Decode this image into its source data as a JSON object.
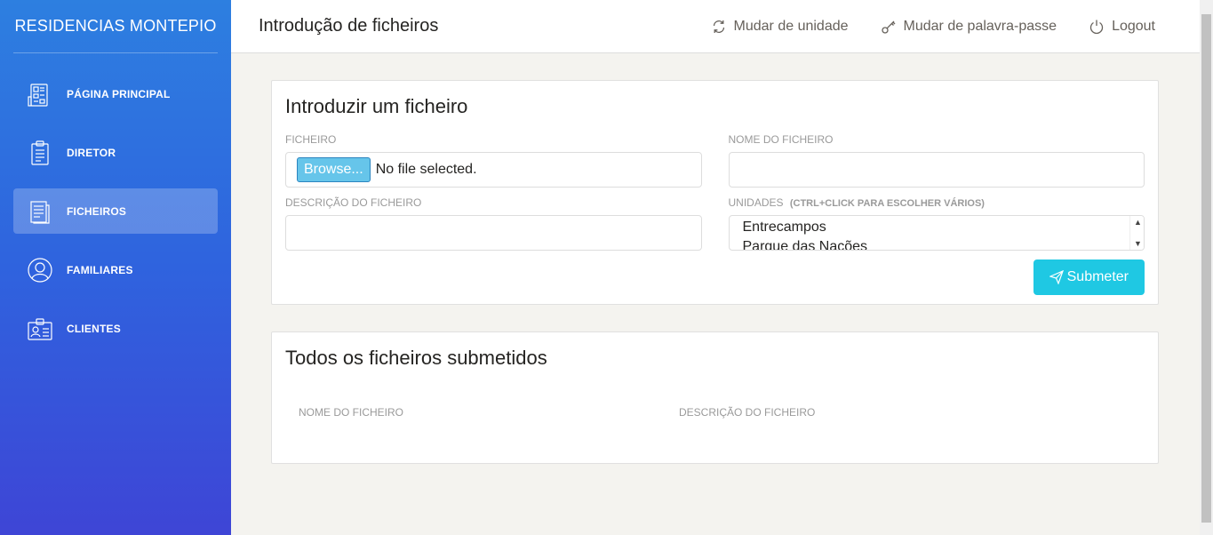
{
  "sidebar": {
    "brand": "RESIDENCIAS MONTEPIO",
    "items": [
      {
        "label": "PÁGINA PRINCIPAL",
        "icon": "dashboard-icon",
        "active": false
      },
      {
        "label": "DIRETOR",
        "icon": "clipboard-icon",
        "active": false
      },
      {
        "label": "FICHEIROS",
        "icon": "document-icon",
        "active": true
      },
      {
        "label": "FAMILIARES",
        "icon": "user-circle-icon",
        "active": false
      },
      {
        "label": "CLIENTES",
        "icon": "id-badge-icon",
        "active": false
      }
    ]
  },
  "header": {
    "title": "Introdução de ficheiros",
    "actions": {
      "change_unit": "Mudar de unidade",
      "change_password": "Mudar de palavra-passe",
      "logout": "Logout"
    }
  },
  "upload_card": {
    "title": "Introduzir um ficheiro",
    "file_label": "FICHEIRO",
    "browse_label": "Browse...",
    "file_status": "No file selected.",
    "filename_label": "NOME DO FICHEIRO",
    "filename_value": "",
    "description_label": "DESCRIÇÃO DO FICHEIRO",
    "description_value": "",
    "units_label": "UNIDADES",
    "units_hint": "(CTRL+CLICK PARA ESCOLHER VÁRIOS)",
    "units_options": [
      "Entrecampos",
      "Parque das Nações"
    ],
    "submit_label": "Submeter"
  },
  "files_card": {
    "title": "Todos os ficheiros submetidos",
    "columns": [
      "NOME DO FICHEIRO",
      "DESCRIÇÃO DO FICHEIRO"
    ]
  },
  "colors": {
    "sidebar_top": "#2d7fe0",
    "sidebar_bottom": "#3e45d6",
    "submit": "#1fc8e3"
  }
}
